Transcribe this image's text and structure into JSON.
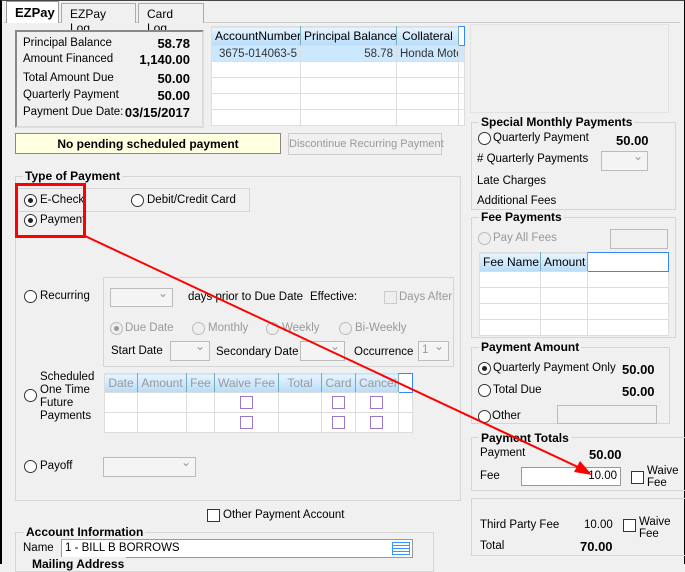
{
  "tabs": [
    {
      "label": "EZPay",
      "selected": true
    },
    {
      "label": "EZPay Log"
    },
    {
      "label": "Card Log"
    }
  ],
  "summary": {
    "principal_balance_label": "Principal Balance",
    "principal_balance": "58.78",
    "amount_financed_label": "Amount Financed",
    "amount_financed": "1,140.00",
    "total_amount_due_label": "Total Amount Due",
    "total_amount_due": "50.00",
    "quarterly_payment_label": "Quarterly Payment",
    "quarterly_payment": "50.00",
    "payment_due_date_label": "Payment Due Date:",
    "payment_due_date": "03/15/2017"
  },
  "accounts_grid": {
    "columns": [
      "AccountNumber",
      "Principal Balance",
      "Collateral"
    ],
    "rows": [
      [
        "3675-014063-5",
        "58.78",
        "Honda Moto"
      ]
    ]
  },
  "pending_status": "No pending scheduled payment",
  "discontinue_button": "Discontinue Recurring Payment",
  "type_of_payment": {
    "title": "Type of Payment",
    "echeck": "E-Check",
    "card": "Debit/Credit Card",
    "payment": "Payment",
    "recurring": "Recurring",
    "days_prior": "days prior to Due Date",
    "effective": "Effective:",
    "days_after": "Days After",
    "due_date": "Due Date",
    "monthly": "Monthly",
    "weekly": "Weekly",
    "biweekly": "Bi-Weekly",
    "start_date": "Start Date",
    "secondary_date": "Secondary Date",
    "occurrence": "Occurrence",
    "occurrence_value": "1",
    "scheduled": "Scheduled One Time Future Payments",
    "scheduled_columns": [
      "Date",
      "Amount",
      "Fee",
      "Waive Fee",
      "Total",
      "Card",
      "Cancel"
    ],
    "payoff": "Payoff"
  },
  "other_payment_account": "Other Payment Account",
  "account_info": {
    "title": "Account Information",
    "name_label": "Name",
    "name_value": "1 - BILL B BORROWS",
    "mailing_address": "Mailing Address"
  },
  "special_monthly": {
    "title": "Special Monthly Payments",
    "quarterly_payment": "Quarterly Payment",
    "quarterly_payment_value": "50.00",
    "num_quarterly": "# Quarterly Payments",
    "late_charges": "Late Charges",
    "additional_fees": "Additional Fees"
  },
  "fee_payments": {
    "title": "Fee Payments",
    "pay_all_fees": "Pay All Fees",
    "columns": [
      "Fee Name",
      "Amount"
    ]
  },
  "payment_amount": {
    "title": "Payment Amount",
    "quarterly_only": "Quarterly Payment Only",
    "quarterly_only_value": "50.00",
    "total_due": "Total Due",
    "total_due_value": "50.00",
    "other": "Other"
  },
  "payment_totals": {
    "title": "Payment Totals",
    "payment_label": "Payment",
    "payment_value": "50.00",
    "fee_label": "Fee",
    "fee_value": "10.00",
    "waive_fee": "Waive Fee",
    "third_party_fee_label": "Third Party Fee",
    "third_party_fee_value": "10.00",
    "total_label": "Total",
    "total_value": "70.00"
  },
  "annotation_color": "#ff0000"
}
